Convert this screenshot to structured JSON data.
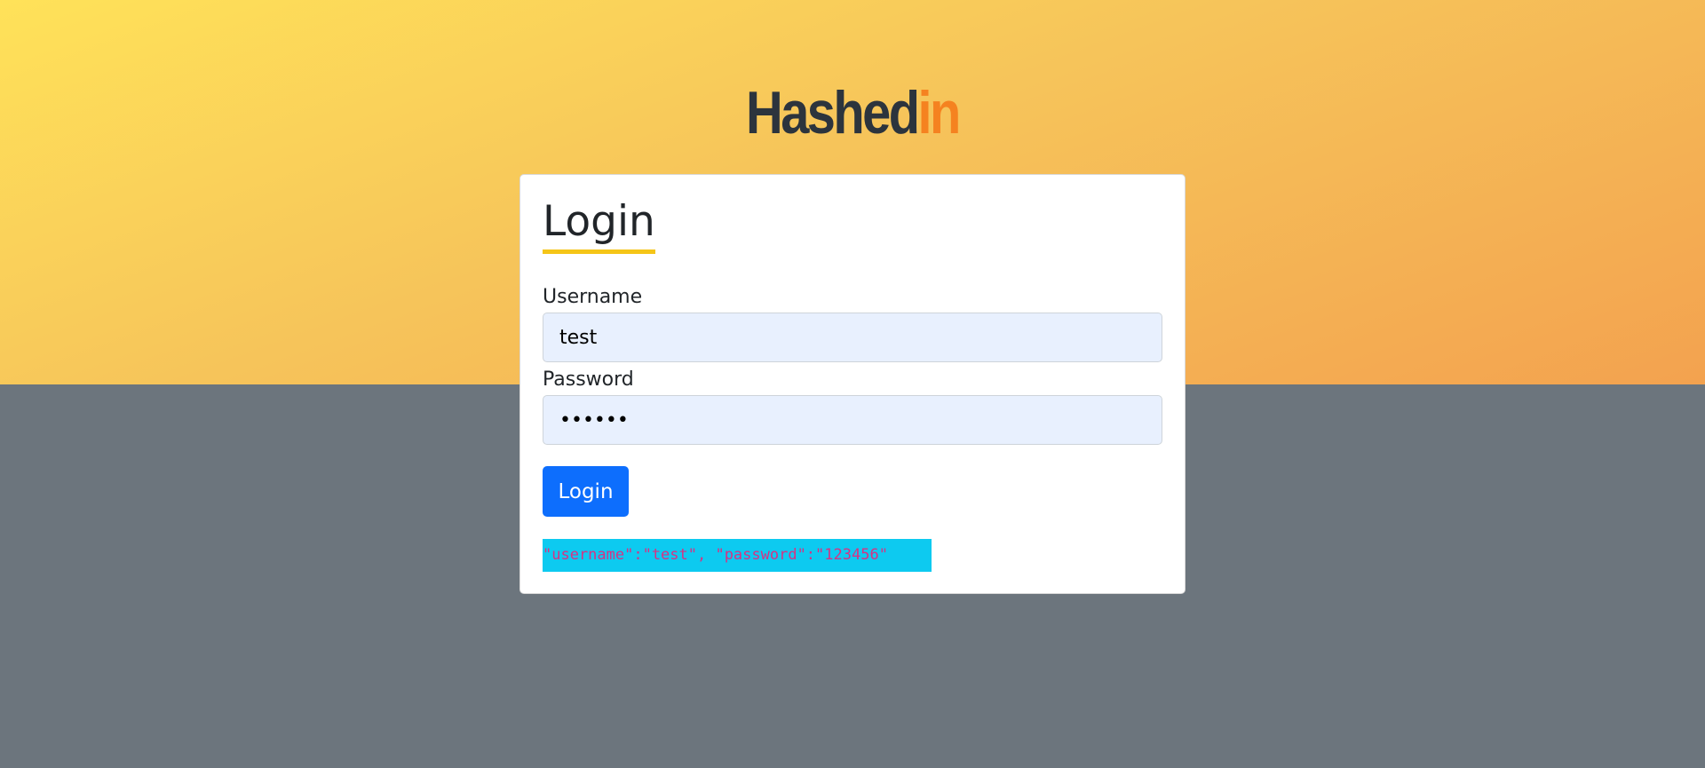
{
  "logo": {
    "main_text": "Hashed",
    "accent_text": "in",
    "main_color": "#2c343d",
    "accent_color": "#f58220"
  },
  "login_form": {
    "title": "Login",
    "username_label": "Username",
    "username_value": "test",
    "password_label": "Password",
    "password_value": "123456",
    "submit_label": "Login"
  },
  "hint": {
    "text": "\"username\":\"test\", \"password\":\"123456\""
  },
  "colors": {
    "primary_button": "#0d6efd",
    "title_underline": "#f5c518",
    "hint_background": "#0dcaf0",
    "hint_text": "#d63384",
    "page_background": "#6c757d"
  }
}
